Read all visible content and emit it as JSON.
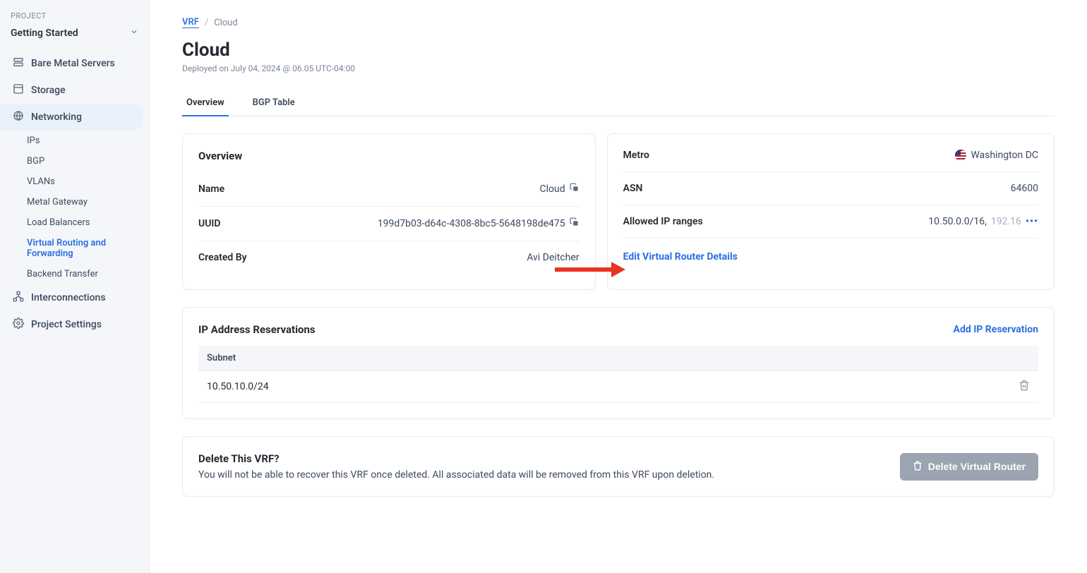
{
  "sidebar": {
    "section_label": "PROJECT",
    "project_name": "Getting Started",
    "items": [
      {
        "label": "Bare Metal Servers",
        "icon": "servers"
      },
      {
        "label": "Storage",
        "icon": "storage"
      },
      {
        "label": "Networking",
        "icon": "globe",
        "active": true
      }
    ],
    "subitems": [
      {
        "label": "IPs"
      },
      {
        "label": "BGP"
      },
      {
        "label": "VLANs"
      },
      {
        "label": "Metal Gateway"
      },
      {
        "label": "Load Balancers"
      },
      {
        "label": "Virtual Routing and Forwarding",
        "selected": true
      },
      {
        "label": "Backend Transfer"
      }
    ],
    "items2": [
      {
        "label": "Interconnections",
        "icon": "hierarchy"
      },
      {
        "label": "Project Settings",
        "icon": "gear"
      }
    ]
  },
  "breadcrumb": {
    "root": "VRF",
    "current": "Cloud"
  },
  "page": {
    "title": "Cloud",
    "subtitle": "Deployed on July 04, 2024 @ 06.05 UTC-04:00"
  },
  "tabs": [
    {
      "label": "Overview",
      "active": true
    },
    {
      "label": "BGP Table"
    }
  ],
  "overview": {
    "card_title": "Overview",
    "rows": {
      "name_label": "Name",
      "name_value": "Cloud",
      "uuid_label": "UUID",
      "uuid_value": "199d7b03-d64c-4308-8bc5-5648198de475",
      "createdby_label": "Created By",
      "createdby_value": "Avi Deitcher"
    }
  },
  "metro": {
    "rows": {
      "metro_label": "Metro",
      "metro_value": "Washington DC",
      "asn_label": "ASN",
      "asn_value": "64600",
      "ipranges_label": "Allowed IP ranges",
      "ipranges_primary": "10.50.0.0/16,",
      "ipranges_secondary": "192.16"
    },
    "edit_label": "Edit Virtual Router Details"
  },
  "reservations": {
    "title": "IP Address Reservations",
    "add_label": "Add IP Reservation",
    "header": "Subnet",
    "rows": [
      {
        "subnet": "10.50.10.0/24"
      }
    ]
  },
  "delete": {
    "title": "Delete This VRF?",
    "body": "You will not be able to recover this VRF once deleted. All associated data will be removed from this VRF upon deletion.",
    "button_label": "Delete Virtual Router"
  }
}
